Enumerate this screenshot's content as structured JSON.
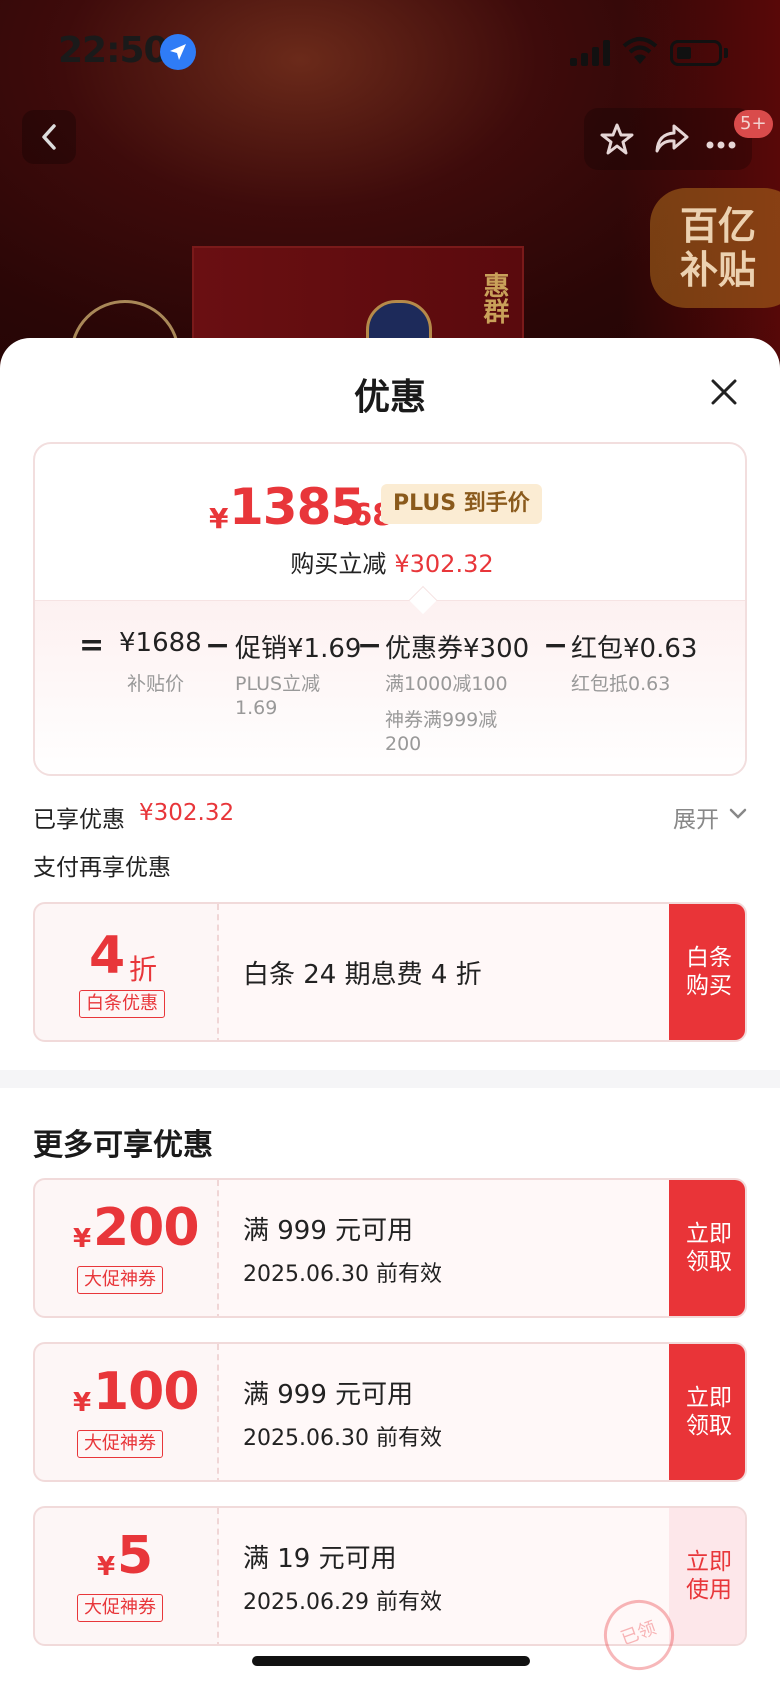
{
  "status": {
    "time": "22:50"
  },
  "product_page": {
    "msg_badge": "5+",
    "subsidy_badge_line1": "百亿",
    "subsidy_badge_line2": "补贴",
    "box_label": "惠群"
  },
  "sheet": {
    "title": "优惠",
    "summary": {
      "price_yen": "¥",
      "price_int": "1385",
      "price_dec": ".68",
      "plus_tag": "PLUS 到手价",
      "instant_label": "购买立减",
      "instant_amount": "¥302.32",
      "formula": {
        "eq": "=",
        "minus": "−",
        "t1": "¥1688",
        "t1_sub": "补贴价",
        "t2": "促销¥1.69",
        "t2_sub1": "PLUS立减",
        "t2_sub2": "1.69",
        "t3": "优惠券¥300",
        "t3_sub1": "满1000减100",
        "t3_sub2": "神券满999减",
        "t3_sub3": "200",
        "t4": "红包¥0.63",
        "t4_sub": "红包抵0.63"
      }
    },
    "enjoyed_label": "已享优惠",
    "enjoyed_amount": "¥302.32",
    "expand_label": "展开",
    "pay_more_label": "支付再享优惠",
    "baitiao": {
      "discount": "4",
      "unit": "折",
      "tag": "白条优惠",
      "desc": "白条 24 期息费 4 折",
      "btn_line1": "白条",
      "btn_line2": "购买"
    },
    "more_title": "更多可享优惠",
    "coupons": [
      {
        "yen": "¥",
        "amount": "200",
        "tag": "大促神券",
        "condition": "满 999 元可用",
        "expiry": "2025.06.30 前有效",
        "btn_line1": "立即",
        "btn_line2": "领取"
      },
      {
        "yen": "¥",
        "amount": "100",
        "tag": "大促神券",
        "condition": "满 999 元可用",
        "expiry": "2025.06.30 前有效",
        "btn_line1": "立即",
        "btn_line2": "领取"
      },
      {
        "yen": "¥",
        "amount": "5",
        "tag": "大促神券",
        "condition": "满 19 元可用",
        "expiry": "2025.06.29 前有效",
        "btn_line1": "立即",
        "btn_line2": "使用"
      }
    ],
    "claimed_stamp": "已领"
  },
  "colors": {
    "accent_red": "#e93438",
    "plus_gold": "#8a5a1c"
  }
}
